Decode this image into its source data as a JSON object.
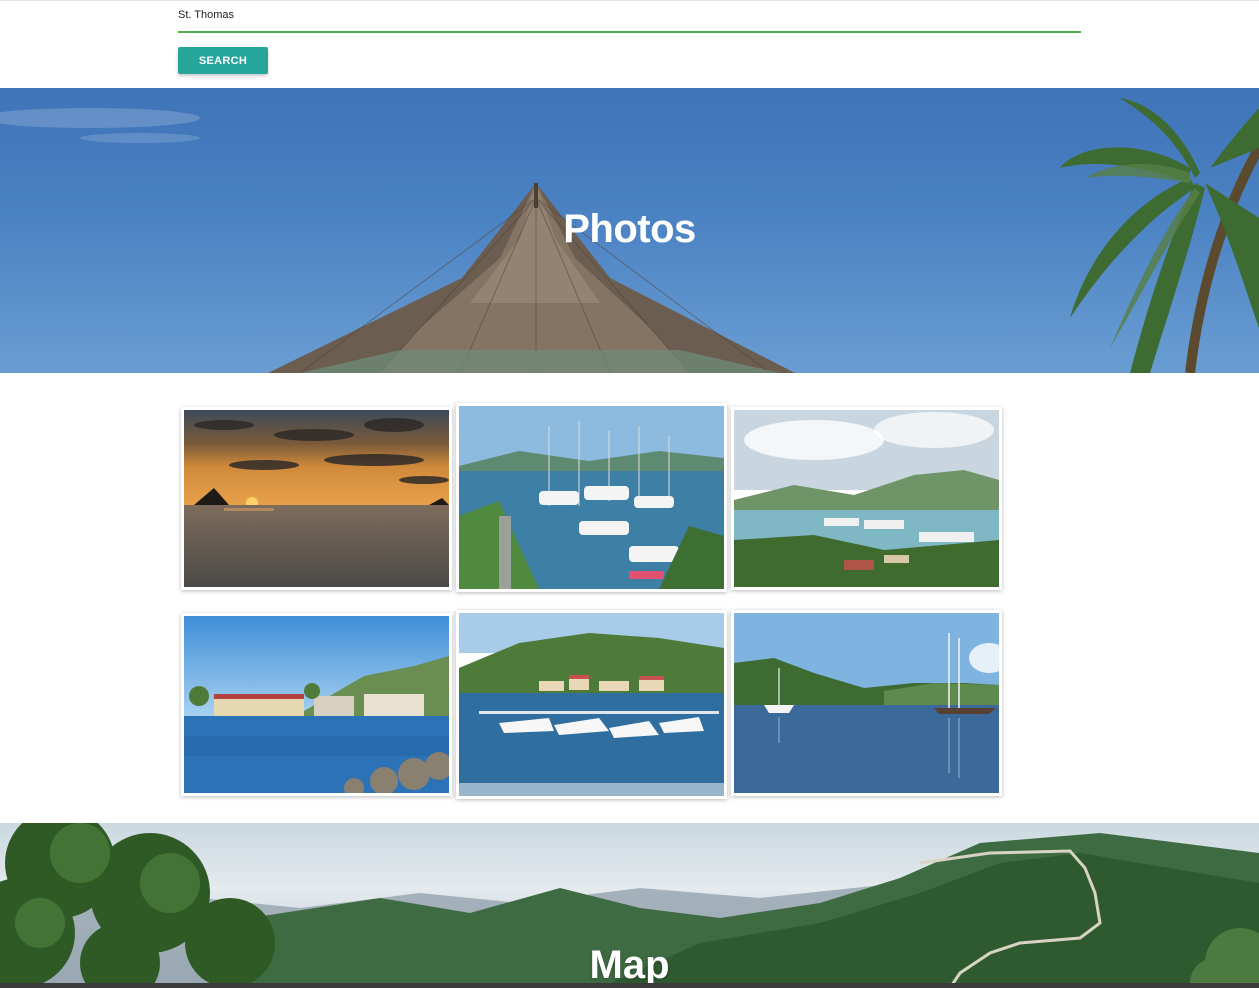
{
  "search": {
    "value": "St. Thomas",
    "button_label": "SEARCH"
  },
  "photos_section": {
    "title": "Photos"
  },
  "gallery": {
    "photos": [
      {
        "name": "sunset-photo"
      },
      {
        "name": "marina-photo"
      },
      {
        "name": "harbor-view-photo"
      },
      {
        "name": "waterfront-town-photo"
      },
      {
        "name": "yacht-harbor-photo"
      },
      {
        "name": "sailboat-bay-photo"
      }
    ]
  },
  "map_section": {
    "title": "Map"
  },
  "colors": {
    "accent": "#26a69a",
    "input_underline": "#4caf50"
  }
}
